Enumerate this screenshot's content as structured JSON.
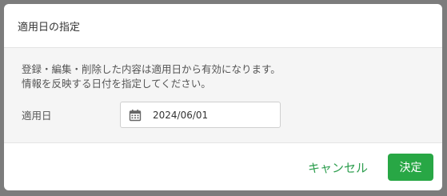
{
  "dialog": {
    "title": "適用日の指定",
    "description_line1": "登録・編集・削除した内容は適用日から有効になります。",
    "description_line2": "情報を反映する日付を指定してください。",
    "field_label": "適用日",
    "date_value": "2024/06/01",
    "cancel_label": "キャンセル",
    "confirm_label": "決定"
  },
  "icons": {
    "date_input": "calendar-icon"
  },
  "colors": {
    "accent": "#28a745",
    "cancel_text": "#2e9e4f"
  }
}
